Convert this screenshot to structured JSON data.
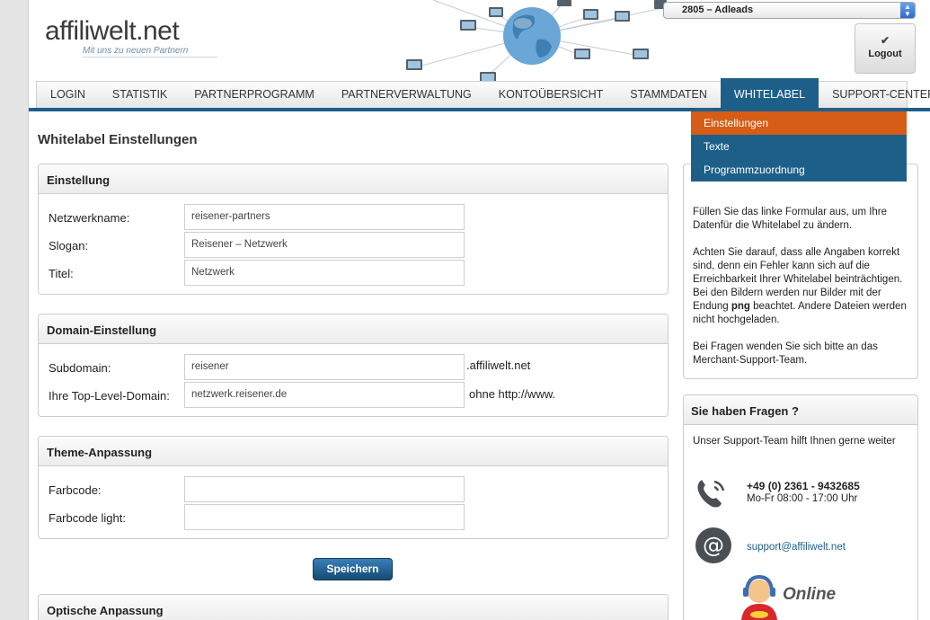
{
  "header": {
    "logo_text": "affiliwelt.net",
    "logo_slogan": "Mit uns zu neuen Partnern",
    "account_select": "2805 – Adleads",
    "logout_label": "Logout"
  },
  "nav": {
    "items": [
      {
        "label": "LOGIN"
      },
      {
        "label": "STATISTIK"
      },
      {
        "label": "PARTNERPROGRAMM"
      },
      {
        "label": "PARTNERVERWALTUNG"
      },
      {
        "label": "KONTOÜBERSICHT"
      },
      {
        "label": "STAMMDATEN"
      },
      {
        "label": "WHITELABEL"
      },
      {
        "label": "SUPPORT-CENTER"
      }
    ],
    "active": "WHITELABEL",
    "submenu": [
      {
        "label": "Einstellungen"
      },
      {
        "label": "Texte"
      },
      {
        "label": "Programmzuordnung"
      }
    ]
  },
  "main": {
    "title": "Whitelabel Einstellungen",
    "sections": [
      {
        "heading": "Einstellung",
        "fields": [
          {
            "label": "Netzwerkname:",
            "value": "reisener-partners",
            "suffix": ""
          },
          {
            "label": "Slogan:",
            "value": "Reisener – Netzwerk",
            "suffix": ""
          },
          {
            "label": "Titel:",
            "value": "Netzwerk",
            "suffix": ""
          }
        ]
      },
      {
        "heading": "Domain-Einstellung",
        "fields": [
          {
            "label": "Subdomain:",
            "value": "reisener",
            "suffix": ".affiliwelt.net"
          },
          {
            "label": "Ihre Top-Level-Domain:",
            "value": "netzwerk.reisener.de",
            "suffix": "ohne http://www."
          }
        ]
      },
      {
        "heading": "Theme-Anpassung",
        "fields": [
          {
            "label": "Farbcode:",
            "value": "",
            "suffix": ""
          },
          {
            "label": "Farbcode light:",
            "value": "",
            "suffix": ""
          }
        ]
      },
      {
        "heading": "Optische Anpassung",
        "fields": []
      }
    ],
    "save_label": "Speichern"
  },
  "sidebar": {
    "info": {
      "para1": "Füllen Sie das linke Formular aus, um Ihre Datenfür die Whitelabel zu ändern.",
      "para2_a": "Achten Sie darauf, dass alle Angaben korrekt sind, denn ein Fehler kann sich auf die Erreichbarkeit Ihrer Whitelabel beinträchtigen. Bei den Bildern werden nur Bilder mit der Endung ",
      "para2_bold": "png",
      "para2_b": " beachtet. Andere Dateien werden nicht hochgeladen.",
      "para3": "Bei Fragen wenden Sie sich bitte an das Merchant-Support-Team."
    },
    "support": {
      "heading": "Sie haben Fragen ?",
      "intro": "Unser Support-Team hilft Ihnen gerne weiter",
      "phone": "+49 (0) 2361 - 9432685",
      "hours": "Mo-Fr 08:00 - 17:00 Uhr",
      "email": "support@affiliwelt.net",
      "online_label": "Online"
    }
  },
  "colors": {
    "nav_active": "#1e5f8a",
    "submenu_selected": "#d65d16",
    "link": "#1e5f8a"
  }
}
